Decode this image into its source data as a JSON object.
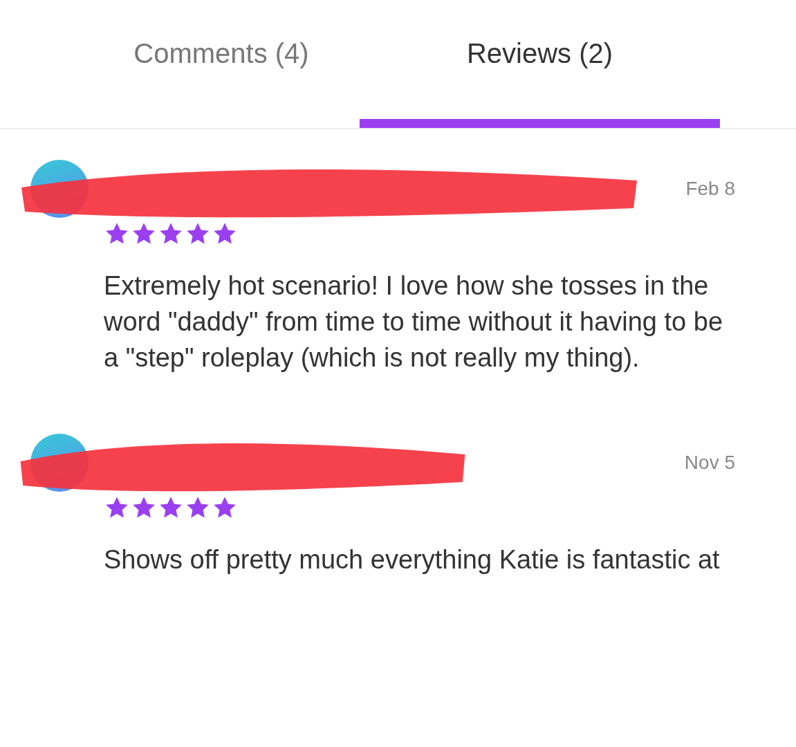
{
  "tabs": [
    {
      "label": "Comments (4)",
      "selected": false
    },
    {
      "label": "Reviews (2)",
      "selected": true
    }
  ],
  "reviews": [
    {
      "date": "Feb 8",
      "stars": 5,
      "text": "Extremely hot scenario! I love how she tosses in the word \"daddy\" from time to time without it having to be a \"step\" roleplay (which is not really my thing)."
    },
    {
      "date": "Nov 5",
      "stars": 5,
      "text": "Shows off pretty much everything Katie is fantastic at"
    }
  ]
}
